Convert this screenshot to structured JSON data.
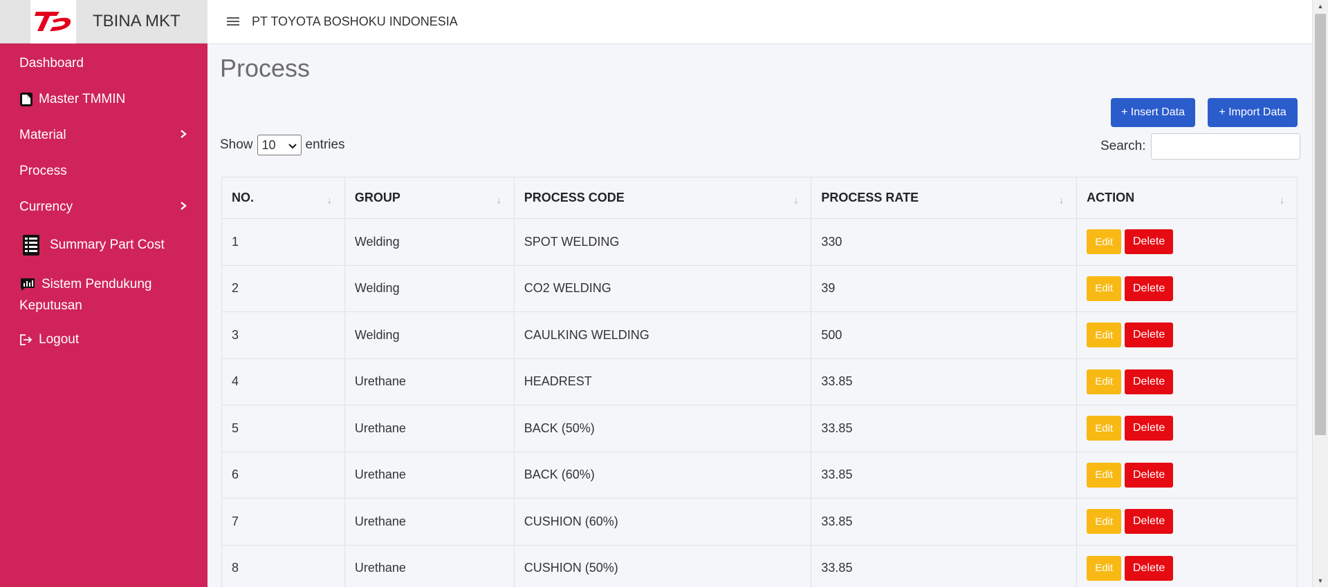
{
  "brand": {
    "name": "TBINA MKT"
  },
  "topbar": {
    "company": "PT TOYOTA BOSHOKU INDONESIA"
  },
  "sidebar": {
    "items": [
      {
        "label": "Dashboard"
      },
      {
        "label": "Master TMMIN"
      },
      {
        "label": "Material"
      },
      {
        "label": "Process"
      },
      {
        "label": "Currency"
      },
      {
        "label": "Summary Part Cost"
      },
      {
        "label_line1": "Sistem Pendukung",
        "label_line2": "Keputusan"
      },
      {
        "label": "Logout"
      }
    ]
  },
  "page": {
    "title": "Process"
  },
  "toolbar": {
    "insert_label": "+ Insert Data",
    "import_label": "+ Import Data"
  },
  "entries": {
    "show_label": "Show",
    "value": "10",
    "suffix": "entries"
  },
  "search": {
    "label": "Search:",
    "value": ""
  },
  "table": {
    "headers": [
      "NO.",
      "GROUP",
      "PROCESS CODE",
      "PROCESS RATE",
      "ACTION"
    ],
    "edit_label": "Edit",
    "delete_label": "Delete",
    "rows": [
      {
        "no": "1",
        "group": "Welding",
        "code": "SPOT WELDING",
        "rate": "330"
      },
      {
        "no": "2",
        "group": "Welding",
        "code": "CO2 WELDING",
        "rate": "39"
      },
      {
        "no": "3",
        "group": "Welding",
        "code": "CAULKING WELDING",
        "rate": "500"
      },
      {
        "no": "4",
        "group": "Urethane",
        "code": "HEADREST",
        "rate": "33.85"
      },
      {
        "no": "5",
        "group": "Urethane",
        "code": "BACK (50%)",
        "rate": "33.85"
      },
      {
        "no": "6",
        "group": "Urethane",
        "code": "BACK (60%)",
        "rate": "33.85"
      },
      {
        "no": "7",
        "group": "Urethane",
        "code": "CUSHION (60%)",
        "rate": "33.85"
      },
      {
        "no": "8",
        "group": "Urethane",
        "code": "CUSHION (50%)",
        "rate": "33.85"
      }
    ]
  },
  "colors": {
    "sidebar": "#d0235a",
    "primary": "#2b5ccc",
    "edit": "#f9b914",
    "delete": "#e60a12"
  }
}
